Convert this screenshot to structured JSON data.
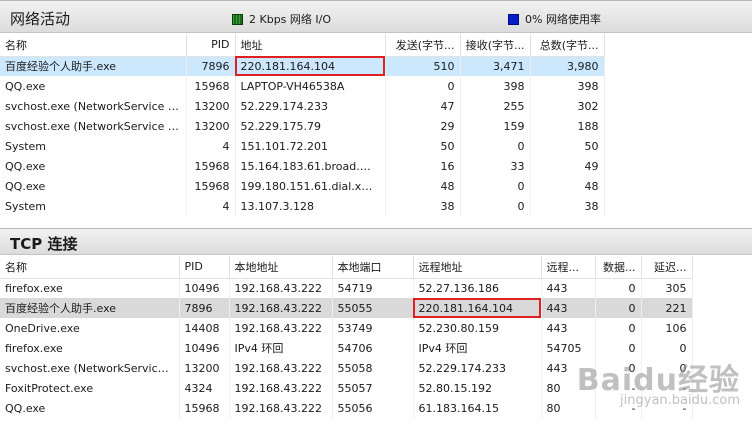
{
  "network": {
    "title": "网络活动",
    "legend_io": "2 Kbps 网络 I/O",
    "legend_usage": "0% 网络使用率",
    "columns": [
      "名称",
      "PID",
      "地址",
      "发送(字节...",
      "接收(字节...",
      "总数(字节..."
    ],
    "rows": [
      [
        "百度经验个人助手.exe",
        "7896",
        "220.181.164.104",
        "510",
        "3,471",
        "3,980"
      ],
      [
        "QQ.exe",
        "15968",
        "LAPTOP-VH46538A",
        "0",
        "398",
        "398"
      ],
      [
        "svchost.exe (NetworkService -p)",
        "13200",
        "52.229.174.233",
        "47",
        "255",
        "302"
      ],
      [
        "svchost.exe (NetworkService -p)",
        "13200",
        "52.229.175.79",
        "29",
        "159",
        "188"
      ],
      [
        "System",
        "4",
        "151.101.72.201",
        "50",
        "0",
        "50"
      ],
      [
        "QQ.exe",
        "15968",
        "15.164.183.61.broad.wh....",
        "16",
        "33",
        "49"
      ],
      [
        "QQ.exe",
        "15968",
        "199.180.151.61.dial.xw.s...",
        "48",
        "0",
        "48"
      ],
      [
        "System",
        "4",
        "13.107.3.128",
        "38",
        "0",
        "38"
      ]
    ]
  },
  "tcp": {
    "title": "TCP 连接",
    "columns": [
      "名称",
      "PID",
      "本地地址",
      "本地端口",
      "远程地址",
      "远程...",
      "数据...",
      "延迟..."
    ],
    "rows": [
      [
        "firefox.exe",
        "10496",
        "192.168.43.222",
        "54719",
        "52.27.136.186",
        "443",
        "0",
        "305"
      ],
      [
        "百度经验个人助手.exe",
        "7896",
        "192.168.43.222",
        "55055",
        "220.181.164.104",
        "443",
        "0",
        "221"
      ],
      [
        "OneDrive.exe",
        "14408",
        "192.168.43.222",
        "53749",
        "52.230.80.159",
        "443",
        "0",
        "106"
      ],
      [
        "firefox.exe",
        "10496",
        "IPv4 环回",
        "54706",
        "IPv4 环回",
        "54705",
        "0",
        "0"
      ],
      [
        "svchost.exe (NetworkService ...",
        "13200",
        "192.168.43.222",
        "55058",
        "52.229.174.233",
        "443",
        "0",
        "0"
      ],
      [
        "FoxitProtect.exe",
        "4324",
        "192.168.43.222",
        "55057",
        "52.80.15.192",
        "80",
        "-",
        "-"
      ],
      [
        "QQ.exe",
        "15968",
        "192.168.43.222",
        "55056",
        "61.183.164.15",
        "80",
        "-",
        "-"
      ]
    ]
  },
  "watermark": {
    "main": "Baidu经验",
    "sub": "jingyan.baidu.com"
  },
  "colors": {
    "highlight_box": "#e02020",
    "selected_row": "#cce8ff",
    "selected_row_inactive": "#d9d9d9"
  }
}
